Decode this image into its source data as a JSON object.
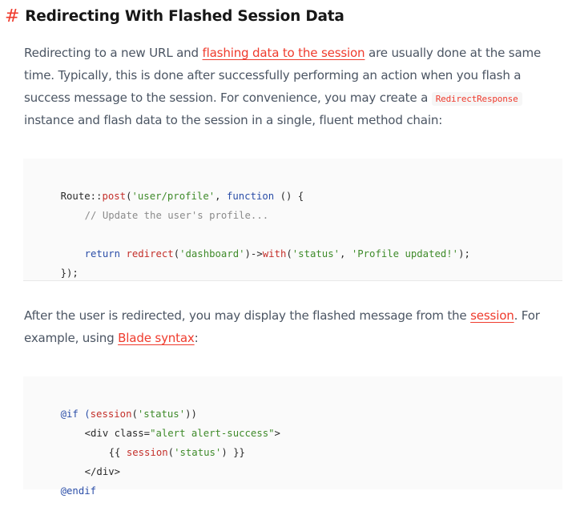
{
  "section": {
    "hash": "#",
    "title": "Redirecting With Flashed Session Data"
  },
  "paragraph1": {
    "l1_a": "Redirecting to a new URL and ",
    "l1_link": "flashing data to the session",
    "l1_b": " are usually done at the same",
    "l2": "time. Typically, this is done after successfully performing an action when you flash a",
    "l3_a": "success message to the session. For convenience, you may create a ",
    "l3_code": "RedirectResponse",
    "l4": "instance and flash data to the session in a single, fluent method chain:"
  },
  "code1": {
    "l1_a": "Route::",
    "l1_b": "post",
    "l1_c": "(",
    "l1_d": "'user/profile'",
    "l1_e": ", ",
    "l1_f": "function",
    "l1_g": " () {",
    "l2": "// Update the user's profile...",
    "l3_a": "return ",
    "l3_b": "redirect",
    "l3_c": "(",
    "l3_d": "'dashboard'",
    "l3_e": ")->",
    "l3_f": "with",
    "l3_g": "(",
    "l3_h": "'status'",
    "l3_i": ", ",
    "l3_j": "'Profile updated!'",
    "l3_k": ");",
    "l4": "});"
  },
  "paragraph2": {
    "l1_a": "After the user is redirected, you may display the flashed message from the ",
    "l1_link": "session",
    "l1_b": ". For",
    "l2_a": "example, using ",
    "l2_link": "Blade syntax",
    "l2_b": ":"
  },
  "code2": {
    "l1_a": "@if (",
    "l1_b": "session",
    "l1_c": "(",
    "l1_d": "'status'",
    "l1_e": "))",
    "l2_a": "<div class=",
    "l2_b": "\"alert alert-success\"",
    "l2_c": ">",
    "l3_a": "{{ ",
    "l3_b": "session",
    "l3_c": "(",
    "l3_d": "'status'",
    "l3_e": ") }}",
    "l4": "</div>",
    "l5": "@endif"
  },
  "colors": {
    "accent": "#ef3b2d",
    "heading": "#171717",
    "body_text": "#4b5563",
    "code_string": "#3f8b2a",
    "code_function": "#c4302b",
    "code_keyword": "#2b4ea8",
    "code_comment": "#8b8b8b",
    "code_background": "#fafafa"
  }
}
